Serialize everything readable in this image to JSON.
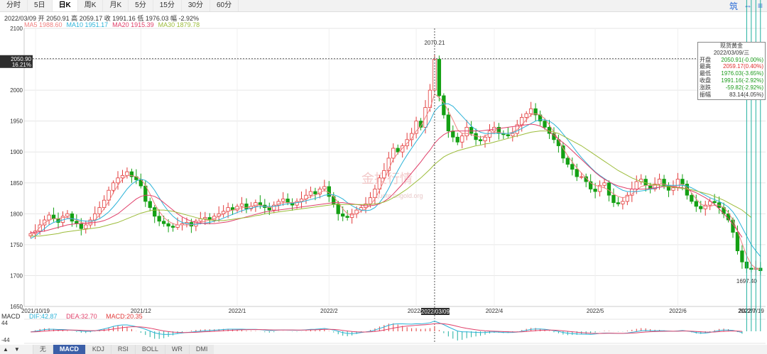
{
  "tabs": [
    "分时",
    "5日",
    "日K",
    "周K",
    "月K",
    "5分",
    "15分",
    "30分",
    "60分"
  ],
  "active_tab": 2,
  "tools": {
    "a": "筑",
    "b": "⇔",
    "c": "≡"
  },
  "info": {
    "date": "2022/03/09",
    "open_label": "开",
    "open": "2050.91",
    "high_label": "高",
    "high": "2059.17",
    "close_label": "收",
    "close": "1991.16",
    "low_label": "低",
    "low": "1976.03",
    "amp_label": "幅",
    "amp": "-2.92%"
  },
  "ma_legend": [
    {
      "label": "MA5",
      "value": "1988.60",
      "color": "#f08080"
    },
    {
      "label": "MA10",
      "value": "1951.17",
      "color": "#2cb3d8"
    },
    {
      "label": "MA20",
      "value": "1915.39",
      "color": "#e0406a"
    },
    {
      "label": "MA30",
      "value": "1879.78",
      "color": "#9cbc3a"
    }
  ],
  "crosshair": {
    "price": "2050.90",
    "pct": "16.21%",
    "date": "2022/03/09",
    "value_label": "2070.21",
    "low_label": "1697.40"
  },
  "panel": {
    "title": "现货黄金",
    "date": "2022/03/09/三",
    "rows": [
      {
        "k": "开盘",
        "v": "2050.91(-0.00%)",
        "color": "#1a9a1a"
      },
      {
        "k": "最高",
        "v": "2059.17(0.40%)",
        "color": "#e03030"
      },
      {
        "k": "最低",
        "v": "1976.03(-3.65%)",
        "color": "#1a9a1a"
      },
      {
        "k": "收盘",
        "v": "1991.16(-2.92%)",
        "color": "#1a9a1a"
      },
      {
        "k": "涨跌",
        "v": "-59.82(-2.92%)",
        "color": "#1a9a1a"
      },
      {
        "k": "振幅",
        "v": "83.14(4.05%)",
        "color": "#333333"
      }
    ]
  },
  "watermark": {
    "main": "金投行情",
    "sub": "quote.cngold.org"
  },
  "macd": {
    "label": "MACD",
    "dif_label": "DIF:",
    "dif": "42.87",
    "dea_label": "DEA:",
    "dea": "32.70",
    "macd_label": "MACD:",
    "macd": "20.35",
    "top": "44",
    "bottom": "-44"
  },
  "bottom_tabs": [
    "无",
    "MACD",
    "KDJ",
    "RSI",
    "BOLL",
    "WR",
    "DMI"
  ],
  "bottom_active": 1,
  "arrows": {
    "up": "▲",
    "down": "▼"
  },
  "colors": {
    "up": "#e23b3b",
    "down": "#14a014",
    "grid": "#e6e6e6"
  },
  "chart_data": {
    "type": "candlestick",
    "y_ticks": [
      1650,
      1700,
      1750,
      1800,
      1850,
      1900,
      1950,
      2000,
      2050,
      2100
    ],
    "ylim": [
      1650,
      2100
    ],
    "x_labels": [
      "2021/10/19",
      "2021/12",
      "2022/1",
      "2022/2",
      "2022/3",
      "2022/4",
      "2022/5",
      "2022/6",
      "2022/7",
      "2022/7/19"
    ],
    "close_series": [
      1768,
      1772,
      1782,
      1790,
      1798,
      1792,
      1786,
      1796,
      1800,
      1788,
      1784,
      1776,
      1782,
      1790,
      1800,
      1810,
      1822,
      1838,
      1850,
      1858,
      1862,
      1868,
      1860,
      1855,
      1845,
      1820,
      1810,
      1796,
      1788,
      1784,
      1780,
      1778,
      1782,
      1784,
      1786,
      1780,
      1788,
      1792,
      1794,
      1790,
      1796,
      1800,
      1804,
      1810,
      1806,
      1812,
      1816,
      1808,
      1812,
      1818,
      1814,
      1810,
      1806,
      1814,
      1820,
      1824,
      1818,
      1814,
      1820,
      1824,
      1830,
      1836,
      1832,
      1840,
      1844,
      1828,
      1816,
      1800,
      1796,
      1794,
      1800,
      1806,
      1810,
      1816,
      1826,
      1840,
      1858,
      1870,
      1890,
      1906,
      1900,
      1910,
      1920,
      1930,
      1950,
      1940,
      1972,
      2000,
      2050,
      1991,
      1960,
      1934,
      1924,
      1916,
      1926,
      1940,
      1930,
      1920,
      1918,
      1924,
      1934,
      1940,
      1930,
      1928,
      1926,
      1930,
      1944,
      1956,
      1962,
      1970,
      1960,
      1950,
      1940,
      1930,
      1920,
      1910,
      1890,
      1880,
      1872,
      1860,
      1860,
      1852,
      1840,
      1836,
      1846,
      1850,
      1830,
      1818,
      1816,
      1820,
      1830,
      1840,
      1852,
      1856,
      1846,
      1840,
      1848,
      1856,
      1846,
      1838,
      1842,
      1856,
      1848,
      1830,
      1820,
      1812,
      1808,
      1814,
      1820,
      1818,
      1810,
      1800,
      1790,
      1770,
      1740,
      1722,
      1712,
      1710,
      1712,
      1708
    ],
    "ma5": [
      1765,
      1770,
      1778,
      1785,
      1790,
      1792,
      1792,
      1794,
      1794,
      1792,
      1790,
      1786,
      1784,
      1786,
      1790,
      1798,
      1808,
      1820,
      1834,
      1846,
      1856,
      1862,
      1862,
      1860,
      1856,
      1846,
      1832,
      1816,
      1804,
      1794,
      1788,
      1784,
      1782,
      1782,
      1782,
      1782,
      1784,
      1786,
      1788,
      1790,
      1792,
      1796,
      1800,
      1804,
      1806,
      1808,
      1810,
      1810,
      1812,
      1814,
      1814,
      1812,
      1810,
      1812,
      1816,
      1818,
      1818,
      1818,
      1818,
      1820,
      1824,
      1828,
      1830,
      1834,
      1838,
      1834,
      1828,
      1818,
      1808,
      1800,
      1798,
      1800,
      1804,
      1808,
      1814,
      1824,
      1838,
      1854,
      1872,
      1888,
      1898,
      1906,
      1914,
      1922,
      1934,
      1942,
      1956,
      1970,
      1994,
      1988,
      1980,
      1966,
      1952,
      1936,
      1930,
      1930,
      1928,
      1926,
      1924,
      1926,
      1930,
      1932,
      1932,
      1930,
      1930,
      1932,
      1936,
      1944,
      1952,
      1960,
      1962,
      1960,
      1954,
      1944,
      1932,
      1920,
      1906,
      1894,
      1884,
      1874,
      1866,
      1858,
      1850,
      1846,
      1844,
      1842,
      1838,
      1832,
      1828,
      1826,
      1828,
      1832,
      1838,
      1844,
      1846,
      1846,
      1846,
      1848,
      1848,
      1846,
      1844,
      1846,
      1848,
      1842,
      1834,
      1824,
      1816,
      1812,
      1812,
      1814,
      1814,
      1810,
      1802,
      1790,
      1772,
      1752,
      1732,
      1718,
      1712,
      1710
    ],
    "ma10": [
      1760,
      1764,
      1770,
      1776,
      1782,
      1786,
      1788,
      1790,
      1792,
      1792,
      1791,
      1789,
      1788,
      1788,
      1789,
      1792,
      1797,
      1803,
      1811,
      1820,
      1830,
      1840,
      1848,
      1853,
      1856,
      1854,
      1848,
      1838,
      1826,
      1814,
      1804,
      1796,
      1790,
      1786,
      1784,
      1783,
      1783,
      1784,
      1785,
      1786,
      1788,
      1790,
      1793,
      1796,
      1799,
      1802,
      1805,
      1807,
      1809,
      1811,
      1812,
      1812,
      1812,
      1812,
      1813,
      1815,
      1816,
      1817,
      1818,
      1819,
      1821,
      1823,
      1825,
      1827,
      1830,
      1831,
      1831,
      1828,
      1824,
      1818,
      1813,
      1809,
      1806,
      1805,
      1806,
      1810,
      1818,
      1828,
      1841,
      1856,
      1870,
      1883,
      1895,
      1906,
      1917,
      1927,
      1938,
      1950,
      1966,
      1974,
      1978,
      1978,
      1974,
      1966,
      1958,
      1950,
      1942,
      1936,
      1932,
      1930,
      1930,
      1930,
      1930,
      1930,
      1930,
      1931,
      1934,
      1938,
      1942,
      1946,
      1950,
      1952,
      1952,
      1950,
      1945,
      1938,
      1929,
      1920,
      1910,
      1900,
      1891,
      1883,
      1875,
      1868,
      1862,
      1857,
      1852,
      1847,
      1842,
      1838,
      1836,
      1836,
      1836,
      1837,
      1838,
      1840,
      1841,
      1843,
      1845,
      1846,
      1846,
      1846,
      1846,
      1845,
      1842,
      1838,
      1834,
      1830,
      1826,
      1823,
      1820,
      1816,
      1811,
      1803,
      1792,
      1778,
      1764,
      1750,
      1740,
      1731
    ],
    "ma20": [
      1770,
      1770,
      1771,
      1772,
      1774,
      1776,
      1778,
      1780,
      1782,
      1783,
      1784,
      1784,
      1785,
      1785,
      1786,
      1787,
      1789,
      1792,
      1796,
      1800,
      1806,
      1812,
      1818,
      1824,
      1828,
      1830,
      1830,
      1828,
      1824,
      1818,
      1812,
      1806,
      1800,
      1795,
      1791,
      1788,
      1786,
      1785,
      1784,
      1784,
      1784,
      1785,
      1786,
      1787,
      1789,
      1791,
      1793,
      1795,
      1797,
      1799,
      1801,
      1803,
      1804,
      1805,
      1806,
      1807,
      1808,
      1809,
      1810,
      1811,
      1812,
      1813,
      1814,
      1815,
      1816,
      1817,
      1818,
      1818,
      1818,
      1817,
      1816,
      1815,
      1814,
      1813,
      1813,
      1814,
      1816,
      1820,
      1825,
      1832,
      1840,
      1848,
      1857,
      1866,
      1875,
      1884,
      1894,
      1903,
      1914,
      1922,
      1928,
      1932,
      1934,
      1934,
      1934,
      1934,
      1934,
      1934,
      1934,
      1935,
      1936,
      1937,
      1938,
      1939,
      1940,
      1941,
      1942,
      1943,
      1944,
      1945,
      1944,
      1942,
      1938,
      1933,
      1927,
      1921,
      1915,
      1909,
      1902,
      1895,
      1888,
      1881,
      1874,
      1867,
      1861,
      1856,
      1852,
      1848,
      1845,
      1843,
      1841,
      1840,
      1840,
      1840,
      1840,
      1841,
      1842,
      1843,
      1844,
      1844,
      1844,
      1843,
      1842,
      1840,
      1837,
      1834,
      1830,
      1826,
      1821,
      1815,
      1808,
      1800,
      1792,
      1783,
      1773,
      1762
    ],
    "ma30": [
      1764,
      1764,
      1764,
      1765,
      1766,
      1767,
      1768,
      1770,
      1771,
      1772,
      1773,
      1774,
      1775,
      1776,
      1777,
      1778,
      1780,
      1782,
      1784,
      1786,
      1789,
      1792,
      1795,
      1798,
      1801,
      1803,
      1805,
      1806,
      1806,
      1806,
      1805,
      1804,
      1802,
      1800,
      1798,
      1796,
      1794,
      1792,
      1791,
      1790,
      1789,
      1789,
      1789,
      1790,
      1791,
      1792,
      1793,
      1794,
      1795,
      1797,
      1798,
      1800,
      1801,
      1802,
      1803,
      1804,
      1805,
      1806,
      1807,
      1808,
      1809,
      1810,
      1811,
      1812,
      1813,
      1814,
      1815,
      1815,
      1815,
      1815,
      1815,
      1815,
      1815,
      1815,
      1815,
      1816,
      1817,
      1819,
      1822,
      1826,
      1830,
      1835,
      1840,
      1846,
      1852,
      1858,
      1865,
      1872,
      1880,
      1886,
      1892,
      1896,
      1899,
      1902,
      1904,
      1906,
      1908,
      1910,
      1911,
      1913,
      1914,
      1916,
      1918,
      1920,
      1922,
      1924,
      1926,
      1928,
      1930,
      1932,
      1933,
      1934,
      1934,
      1934,
      1932,
      1930,
      1926,
      1922,
      1918,
      1914,
      1910,
      1905,
      1900,
      1895,
      1890,
      1885,
      1880,
      1875,
      1870,
      1866,
      1862,
      1858,
      1855,
      1852,
      1850,
      1848,
      1847,
      1846,
      1845,
      1844,
      1843,
      1842,
      1841,
      1840,
      1839,
      1837,
      1835,
      1833,
      1831,
      1828,
      1825,
      1822,
      1818,
      1814,
      1810,
      1806,
      1800,
      1794
    ]
  }
}
